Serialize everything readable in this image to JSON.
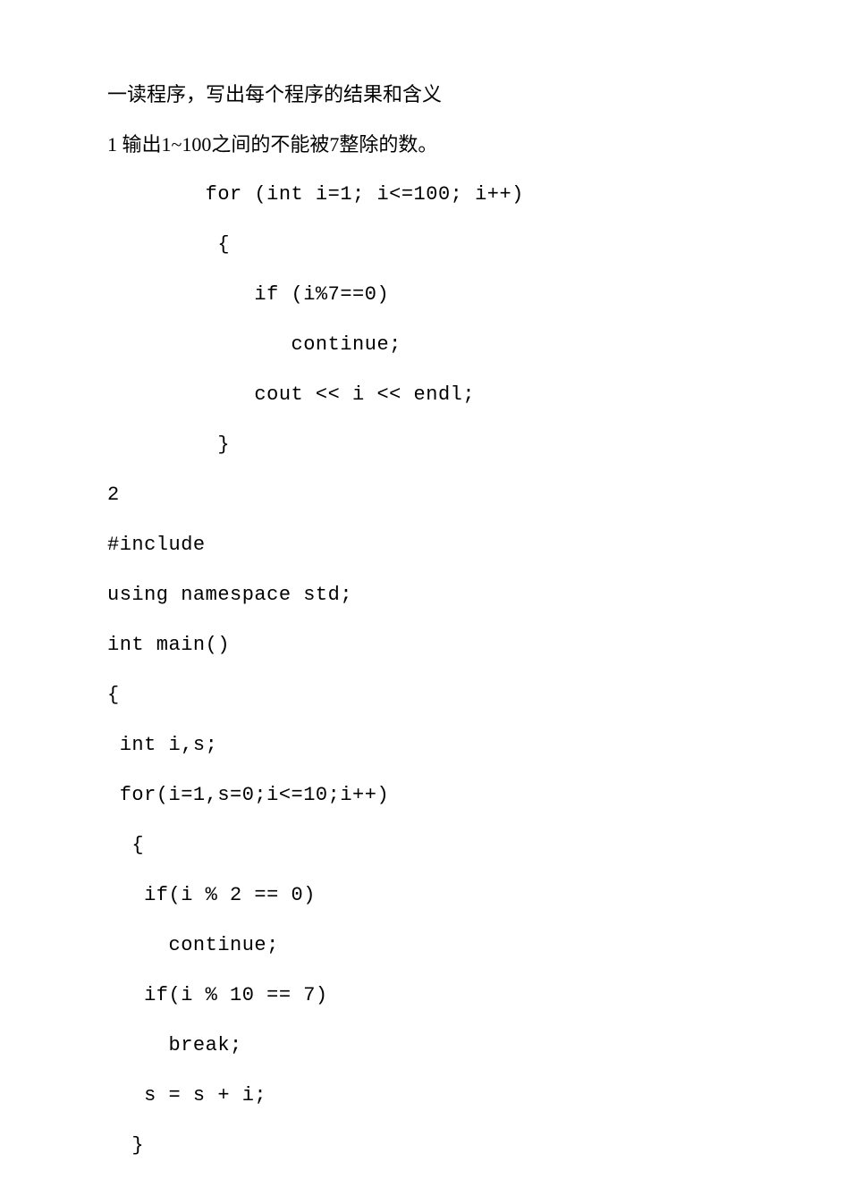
{
  "lines": [
    {
      "cls": "line",
      "text": "一读程序，写出每个程序的结果和含义"
    },
    {
      "cls": "line",
      "text": "1 输出1~100之间的不能被7整除的数。"
    },
    {
      "cls": "line mono",
      "text": "        for (int i=1; i<=100; i++)"
    },
    {
      "cls": "line mono",
      "text": "         {"
    },
    {
      "cls": "line mono",
      "text": "            if (i%7==0)"
    },
    {
      "cls": "line mono",
      "text": "               continue;"
    },
    {
      "cls": "line mono",
      "text": "            cout << i << endl;"
    },
    {
      "cls": "line mono",
      "text": "         }"
    },
    {
      "cls": "line mono",
      "text": "2"
    },
    {
      "cls": "line mono",
      "text": "#include"
    },
    {
      "cls": "line mono",
      "text": "using namespace std;"
    },
    {
      "cls": "line mono",
      "text": "int main()"
    },
    {
      "cls": "line mono",
      "text": "{"
    },
    {
      "cls": "line mono2",
      "text": " int i,s;"
    },
    {
      "cls": "line mono2",
      "text": " for(i=1,s=0;i<=10;i++)"
    },
    {
      "cls": "line mono2",
      "text": "  {"
    },
    {
      "cls": "line mono2",
      "text": "   if(i % 2 == 0)"
    },
    {
      "cls": "line mono2",
      "text": "     continue;"
    },
    {
      "cls": "line mono2",
      "text": "   if(i % 10 == 7)"
    },
    {
      "cls": "line mono2",
      "text": "     break;"
    },
    {
      "cls": "line mono2",
      "text": "   s = s + i;"
    },
    {
      "cls": "line mono2",
      "text": "  }"
    }
  ]
}
